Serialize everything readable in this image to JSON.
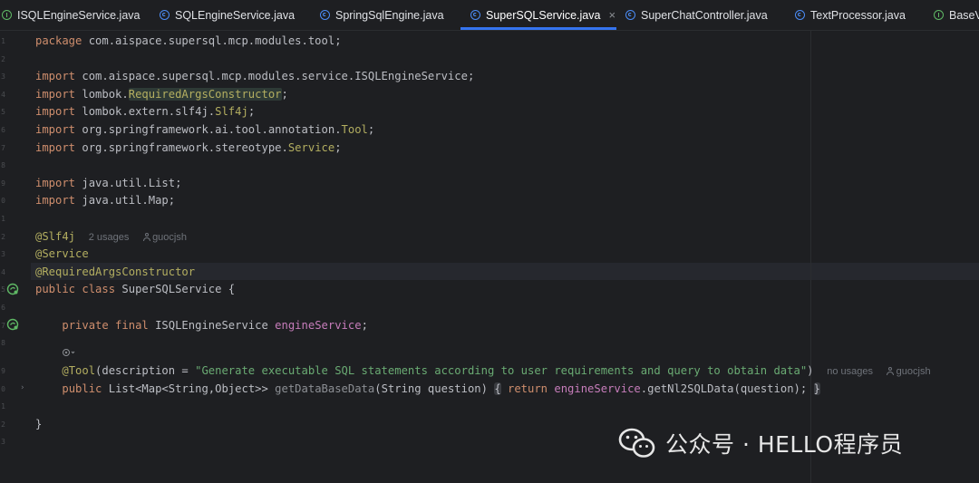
{
  "tabs": [
    {
      "label": "ISQLEngineService.java",
      "icon": "interface-icon",
      "active": false
    },
    {
      "label": "SQLEngineService.java",
      "icon": "class-icon",
      "active": false
    },
    {
      "label": "SpringSqlEngine.java",
      "icon": "class-icon",
      "active": false
    },
    {
      "label": "SuperSQLService.java",
      "icon": "class-icon",
      "active": true,
      "close": "×"
    },
    {
      "label": "SuperChatController.java",
      "icon": "class-icon",
      "active": false
    },
    {
      "label": "TextProcessor.java",
      "icon": "class-icon",
      "active": false
    },
    {
      "label": "BaseV",
      "icon": "interface-icon",
      "active": false
    }
  ],
  "code": {
    "package_kw": "package",
    "package_name": " com.aispace.supersql.mcp.modules.tool;",
    "imports": [
      {
        "kw": "import",
        "path": " com.aispace.supersql.mcp.modules.service.ISQLEngineService",
        "cls": "",
        "end": ";"
      },
      {
        "kw": "import",
        "path": " lombok.",
        "cls": "RequiredArgsConstructor",
        "end": ";"
      },
      {
        "kw": "import",
        "path": " lombok.extern.slf4j.",
        "cls": "Slf4j",
        "end": ";"
      },
      {
        "kw": "import",
        "path": " org.springframework.ai.tool.annotation.",
        "cls": "Tool",
        "end": ";"
      },
      {
        "kw": "import",
        "path": " org.springframework.stereotype.",
        "cls": "Service",
        "end": ";"
      },
      {
        "kw": "import",
        "path": " java.util.List",
        "cls": "",
        "end": ";"
      },
      {
        "kw": "import",
        "path": " java.util.Map",
        "cls": "",
        "end": ";"
      }
    ],
    "ann_slf4j": "@Slf4j",
    "hint_usages": "2 usages",
    "hint_author": "guocjsh",
    "ann_service": "@Service",
    "ann_rac": "@RequiredArgsConstructor",
    "class_kw": "public class",
    "class_name": " SuperSQLService {",
    "field_kw": "private final",
    "field_type": " ISQLEngineService ",
    "field_name": "engineService",
    "field_end": ";",
    "tool_ann": "@Tool",
    "tool_open": "(description = ",
    "tool_desc": "\"Generate executable SQL statements according to user requirements and query to obtain data\"",
    "tool_close": ")",
    "hint_no_usages": "no usages",
    "hint_author2": "guocjsh",
    "method_kw": "public",
    "method_ret": " List<Map<String,Object>> ",
    "method_name": "getDataBaseData",
    "method_params": "(String question) ",
    "brace_open": "{",
    "return_kw": "return",
    "call_target": "engineService",
    "call_rest": ".getNl2SQLData(question);",
    "brace_close": "}",
    "class_close": "}"
  },
  "watermark": {
    "label": "公众号 · HELLO程序员"
  },
  "colors": {
    "background": "#1e1f22",
    "keyword": "#cf8e6d",
    "annotation": "#b3ae60",
    "string": "#6aab73",
    "field": "#c77dbb",
    "tab_active_underline": "#3574f0"
  }
}
